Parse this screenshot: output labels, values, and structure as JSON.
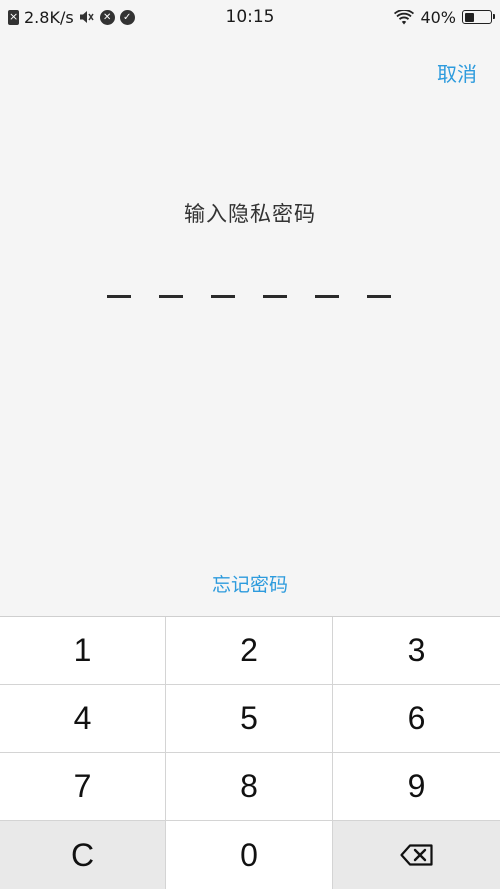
{
  "status_bar": {
    "speed": "2.8K/s",
    "time": "10:15",
    "battery": "40%",
    "battery_level": 0.4,
    "icons": [
      "sim-off-icon",
      "mute-icon",
      "close-circle-icon",
      "check-circle-icon",
      "wifi-icon",
      "battery-icon"
    ]
  },
  "header": {
    "cancel_label": "取消"
  },
  "main": {
    "title": "输入隐私密码",
    "pin_length": 6,
    "forgot_label": "忘记密码"
  },
  "keypad": {
    "keys": [
      "1",
      "2",
      "3",
      "4",
      "5",
      "6",
      "7",
      "8",
      "9",
      "C",
      "0",
      "backspace-icon"
    ]
  },
  "colors": {
    "accent": "#2d9bdd",
    "background": "#f5f5f5",
    "key_bg": "#ffffff",
    "special_key_bg": "#e9e9e9"
  }
}
